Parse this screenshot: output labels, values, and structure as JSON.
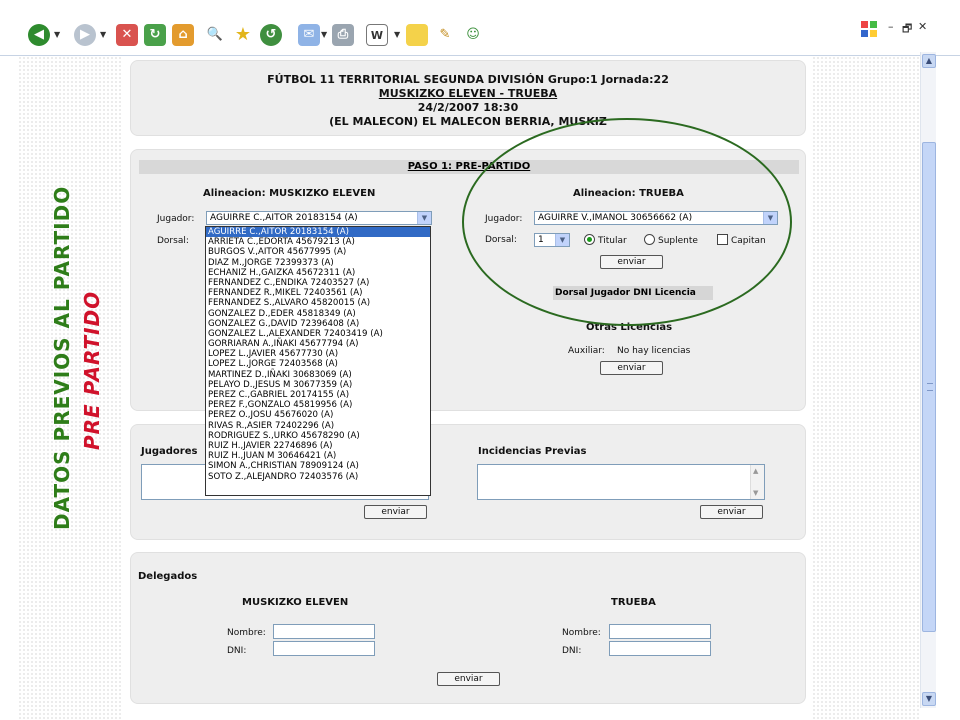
{
  "toolbar": {
    "icons": [
      "back-icon",
      "forward-icon",
      "stop-icon",
      "refresh-icon",
      "home-icon",
      "search-icon",
      "favorites-icon",
      "history-icon",
      "mail-icon",
      "print-icon",
      "edit-icon",
      "discuss-icon",
      "messenger-icon",
      "notes-icon"
    ],
    "window_controls": {
      "minimize": "–",
      "restore": "🗗",
      "close": "✕"
    }
  },
  "side_labels": {
    "green": "DATOS  PREVIOS AL PARTIDO",
    "red": "PRE PARTIDO"
  },
  "header": {
    "line1": "FÚTBOL 11 TERRITORIAL SEGUNDA DIVISIÓN Grupo:1 Jornada:22",
    "line2": "MUSKIZKO ELEVEN  - TRUEBA",
    "line3": "24/2/2007 18:30",
    "line4": "(EL MALECON) EL MALECON BERRIA, MUSKIZ"
  },
  "paso": {
    "title": "PASO 1: PRE-PARTIDO",
    "home": {
      "title": "Alineacion: MUSKIZKO ELEVEN",
      "jugador_label": "Jugador:",
      "jugador_value": "AGUIRRE C.,AITOR 20183154 (A)",
      "dorsal_label": "Dorsal:"
    },
    "away": {
      "title": "Alineacion: TRUEBA",
      "jugador_label": "Jugador:",
      "jugador_value": "AGUIRRE V.,IMANOL 30656662 (A)",
      "dorsal_label": "Dorsal:",
      "dorsal_value": "1",
      "titular": "Titular",
      "suplente": "Suplente",
      "capitan": "Capitan",
      "send": "enviar",
      "table_header": "Dorsal Jugador DNI Licencia"
    },
    "otras": {
      "title": "Otras Licencias",
      "auxiliar_label": "Auxiliar:",
      "auxiliar_value": "No hay licencias",
      "send": "enviar"
    },
    "dropdown_options": [
      "AGUIRRE C.,AITOR 20183154 (A)",
      "ARRIETA C.,EDORTA 45679213 (A)",
      "BURGOS V.,AITOR 45677995 (A)",
      "DIAZ M.,JORGE 72399373 (A)",
      "ECHANIZ H.,GAIZKA 45672311 (A)",
      "FERNANDEZ C.,ENDIKA 72403527 (A)",
      "FERNANDEZ R.,MIKEL 72403561 (A)",
      "FERNANDEZ S.,ALVARO 45820015 (A)",
      "GONZALEZ D.,EDER 45818349 (A)",
      "GONZALEZ G.,DAVID 72396408 (A)",
      "GONZALEZ L.,ALEXANDER 72403419 (A)",
      "GORRIARAN A.,IÑAKI 45677794 (A)",
      "LOPEZ L.,JAVIER 45677730 (A)",
      "LOPEZ L.,JORGE 72403568 (A)",
      "MARTINEZ D.,IÑAKI 30683069 (A)",
      "PELAYO D.,JESUS M 30677359 (A)",
      "PEREZ C.,GABRIEL 20174155 (A)",
      "PEREZ F.,GONZALO 45819956 (A)",
      "PEREZ O.,JOSU 45676020 (A)",
      "RIVAS R.,ASIER 72402296 (A)",
      "RODRIGUEZ S.,URKO 45678290 (A)",
      "RUIZ H.,JAVIER 22746896 (A)",
      "RUIZ H.,JUAN M 30646421 (A)",
      "SIMON A.,CHRISTIAN 78909124 (A)",
      "SOTO Z.,ALEJANDRO 72403576 (A)"
    ]
  },
  "jugadores": {
    "title": "Jugadores",
    "send": "enviar",
    "incidencias_title": "Incidencias Previas",
    "incidencias_send": "enviar"
  },
  "delegados": {
    "title": "Delegados",
    "home_team": "MUSKIZKO ELEVEN",
    "away_team": "TRUEBA",
    "nombre_label": "Nombre:",
    "dni_label": "DNI:",
    "send": "enviar"
  }
}
